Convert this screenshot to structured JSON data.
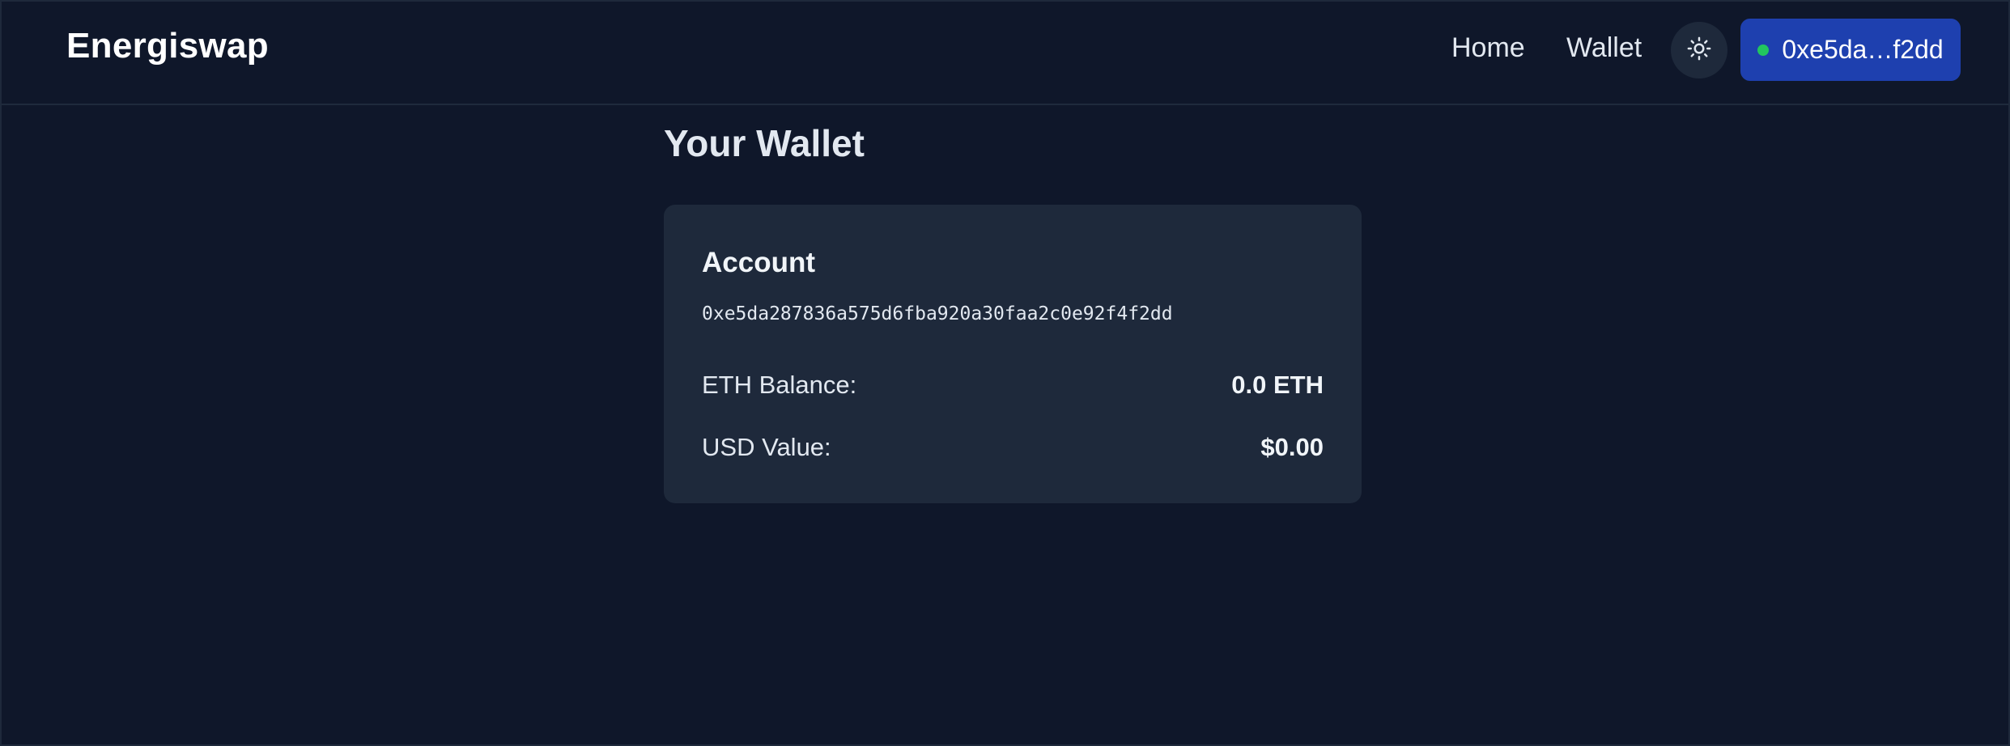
{
  "header": {
    "brand": "Energiswap",
    "nav": {
      "home": "Home",
      "wallet": "Wallet"
    },
    "theme_toggle_icon": "sun-icon",
    "wallet_button": {
      "label": "0xe5da…f2dd",
      "status_color": "#22c55e"
    }
  },
  "main": {
    "title": "Your Wallet",
    "account_card": {
      "title": "Account",
      "address": "0xe5da287836a575d6fba920a30faa2c0e92f4f2dd",
      "rows": [
        {
          "label": "ETH Balance:",
          "value": "0.0 ETH"
        },
        {
          "label": "USD Value:",
          "value": "$0.00"
        }
      ]
    }
  },
  "colors": {
    "background": "#0f172a",
    "card": "#1e293b",
    "accent": "#1e40af",
    "status_online": "#22c55e"
  }
}
